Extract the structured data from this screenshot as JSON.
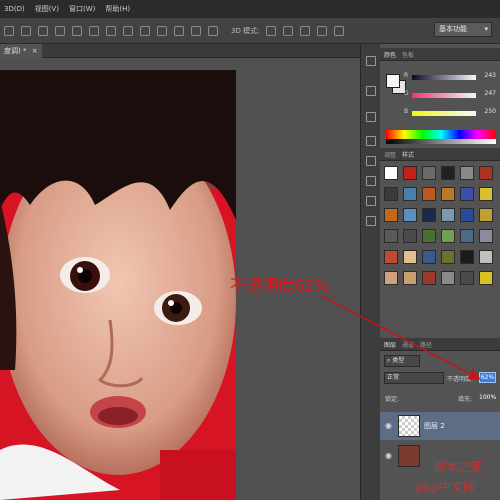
{
  "menubar": {
    "items": [
      "3D(D)",
      "视图(V)",
      "窗口(W)",
      "帮助(H)"
    ]
  },
  "options": {
    "mode_3d": "3D 模式:",
    "workspace": "基本功能"
  },
  "document": {
    "tab_label": "度调) *",
    "close": "×"
  },
  "annotation": {
    "text": "不透明度62%",
    "color": "#e2161a"
  },
  "color_panel": {
    "tabs": [
      "颜色",
      "色板"
    ],
    "channels": [
      {
        "label": "R",
        "value": "243",
        "gradient": "linear-gradient(to right,#0a0a28,#f5f8ff)"
      },
      {
        "label": "G",
        "value": "247",
        "gradient": "linear-gradient(to right,#f2366a,#f3f7fa)"
      },
      {
        "label": "B",
        "value": "250",
        "gradient": "linear-gradient(to right,#f3f717,#f3f7fa)"
      }
    ]
  },
  "styles_panel": {
    "tabs": [
      "调整",
      "样式"
    ],
    "swatches": [
      "#ffffff",
      "#c0211b",
      "#6a6a6a",
      "#222222",
      "#8a8a8a",
      "#aa3322",
      "#3a3a3a",
      "#4a7fb0",
      "#c05a1a",
      "#b87a2a",
      "#3a4fb0",
      "#d8c030",
      "#c06a1a",
      "#5a90c0",
      "#1a2a4a",
      "#7a9ab0",
      "#2a4a9a",
      "#c0a030",
      "#5a5a5a",
      "#4a4a4a",
      "#4a7030",
      "#70a050",
      "#4a6a8a",
      "#8a8aa0",
      "#c04a30",
      "#e0c090",
      "#3a5a8a",
      "#707030",
      "#1a1a1a",
      "#c0c0c0",
      "#d0a080",
      "#c8a070",
      "#9a3a2a",
      "#8a8a8a",
      "#4a4a4a",
      "#d8c020"
    ]
  },
  "layers_panel": {
    "tabs": [
      "图层",
      "通道",
      "路径"
    ],
    "filter_kind": "类型",
    "blend_mode": "正常",
    "opacity_label": "不透明度:",
    "opacity_value": "62%",
    "lock_label": "锁定:",
    "fill_label": "填充:",
    "fill_value": "100%",
    "layers": [
      {
        "name": "图层 2",
        "visible": true,
        "active": true
      },
      {
        "name": "",
        "visible": true,
        "active": false
      }
    ],
    "eye_icon": "◉"
  },
  "watermark": {
    "line1": "脚本之家",
    "line2": "php中文网"
  }
}
